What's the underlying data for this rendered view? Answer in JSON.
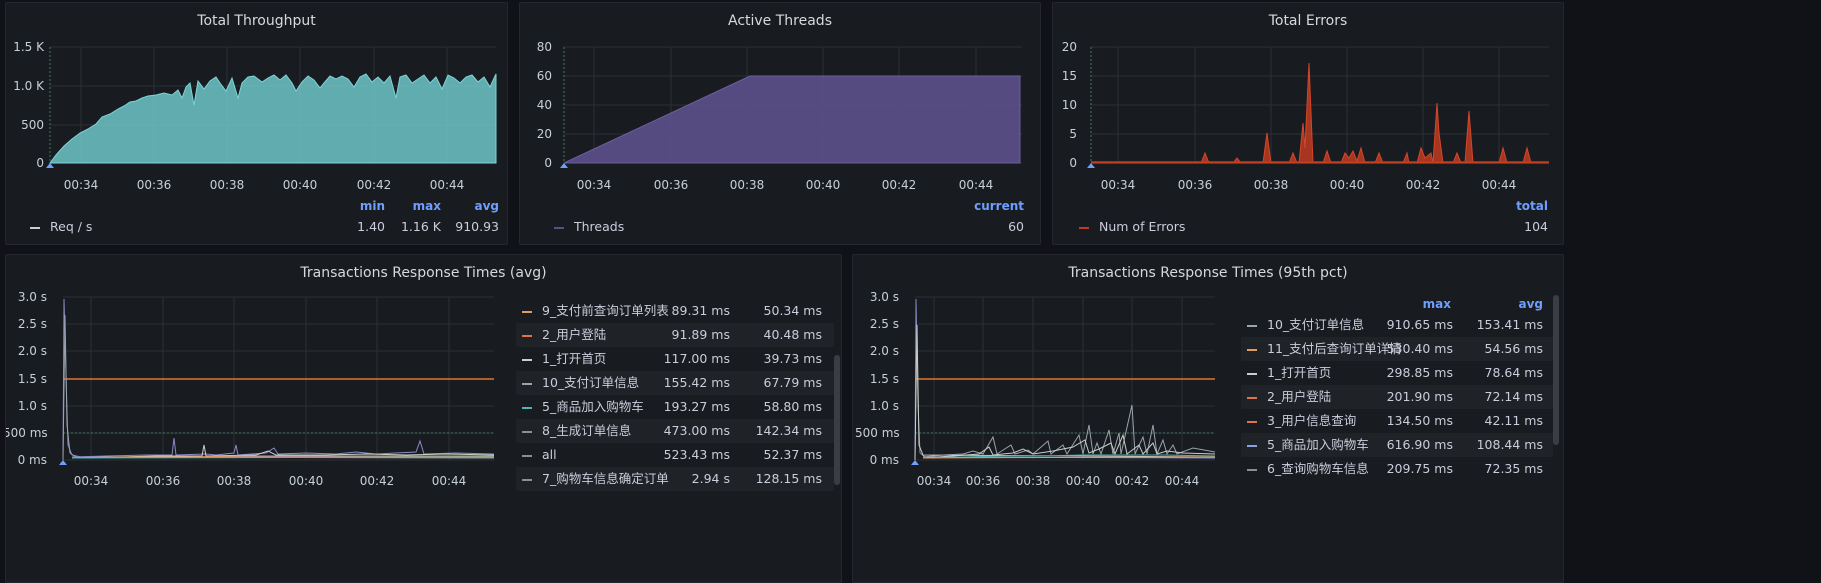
{
  "panels": {
    "throughput": {
      "title": "Total Throughput",
      "yticks": [
        "1.5 K",
        "1.0 K",
        "500",
        "0"
      ],
      "xticks": [
        "00:34",
        "00:36",
        "00:38",
        "00:40",
        "00:42",
        "00:44"
      ],
      "legend_headers": [
        "min",
        "max",
        "avg"
      ],
      "legend_label": "Req / s",
      "legend_values": [
        "1.40",
        "1.16 K",
        "910.93"
      ],
      "color": "#6fc5c9"
    },
    "threads": {
      "title": "Active Threads",
      "yticks": [
        "80",
        "60",
        "40",
        "20",
        "0"
      ],
      "xticks": [
        "00:34",
        "00:36",
        "00:38",
        "00:40",
        "00:42",
        "00:44"
      ],
      "legend_headers": [
        "current"
      ],
      "legend_label": "Threads",
      "legend_values": [
        "60"
      ],
      "color": "#5a4e86"
    },
    "errors": {
      "title": "Total Errors",
      "yticks": [
        "20",
        "15",
        "10",
        "5",
        "0"
      ],
      "xticks": [
        "00:34",
        "00:36",
        "00:38",
        "00:40",
        "00:42",
        "00:44"
      ],
      "legend_headers": [
        "total"
      ],
      "legend_label": "Num of Errors",
      "legend_values": [
        "104"
      ],
      "color": "#bf3b20"
    },
    "resp_avg": {
      "title": "Transactions Response Times (avg)",
      "yticks": [
        "3.0 s",
        "2.5 s",
        "2.0 s",
        "1.5 s",
        "1.0 s",
        "500 ms",
        "0 ms"
      ],
      "xticks": [
        "00:34",
        "00:36",
        "00:38",
        "00:40",
        "00:42",
        "00:44"
      ],
      "rows": [
        {
          "name": "9_支付前查询订单列表",
          "max": "89.31 ms",
          "avg": "50.34 ms",
          "color": "#e0995e"
        },
        {
          "name": "2_用户登陆",
          "max": "91.89 ms",
          "avg": "40.48 ms",
          "color": "#e0734f"
        },
        {
          "name": "1_打开首页",
          "max": "117.00 ms",
          "avg": "39.73 ms",
          "color": "#c8d0c8"
        },
        {
          "name": "10_支付订单信息",
          "max": "155.42 ms",
          "avg": "67.79 ms",
          "color": "#9aa3ac"
        },
        {
          "name": "5_商品加入购物车",
          "max": "193.27 ms",
          "avg": "58.80 ms",
          "color": "#4fb5b2"
        },
        {
          "name": "8_生成订单信息",
          "max": "473.00 ms",
          "avg": "142.34 ms",
          "color": "#8e8e8e"
        },
        {
          "name": "all",
          "max": "523.43 ms",
          "avg": "52.37 ms",
          "color": "#8e8e8e"
        },
        {
          "name": "7_购物车信息确定订单",
          "max": "2.94 s",
          "avg": "128.15 ms",
          "color": "#8e8e8e"
        }
      ]
    },
    "resp_p95": {
      "title": "Transactions Response Times (95th pct)",
      "yticks": [
        "3.0 s",
        "2.5 s",
        "2.0 s",
        "1.5 s",
        "1.0 s",
        "500 ms",
        "0 ms"
      ],
      "xticks": [
        "00:34",
        "00:36",
        "00:38",
        "00:40",
        "00:42",
        "00:44"
      ],
      "headers": [
        "max",
        "avg"
      ],
      "rows": [
        {
          "name": "10_支付订单信息",
          "max": "910.65 ms",
          "avg": "153.41 ms",
          "color": "#9aa3ac"
        },
        {
          "name": "11_支付后查询订单详情",
          "max": "530.40 ms",
          "avg": "54.56 ms",
          "color": "#e0995e"
        },
        {
          "name": "1_打开首页",
          "max": "298.85 ms",
          "avg": "78.64 ms",
          "color": "#c8d0c8"
        },
        {
          "name": "2_用户登陆",
          "max": "201.90 ms",
          "avg": "72.14 ms",
          "color": "#e0734f"
        },
        {
          "name": "3_用户信息查询",
          "max": "134.50 ms",
          "avg": "42.11 ms",
          "color": "#e0734f"
        },
        {
          "name": "5_商品加入购物车",
          "max": "616.90 ms",
          "avg": "108.44 ms",
          "color": "#8aa0e0"
        },
        {
          "name": "6_查询购物车信息",
          "max": "209.75 ms",
          "avg": "72.35 ms",
          "color": "#8e8e8e"
        }
      ]
    }
  },
  "colors": {
    "background": "#111217",
    "panel": "#181b1f",
    "grid": "#2c3035",
    "threshold_orange": "#e0752d",
    "threshold_green": "#3d7a66",
    "header_blue": "#6e9fff"
  }
}
